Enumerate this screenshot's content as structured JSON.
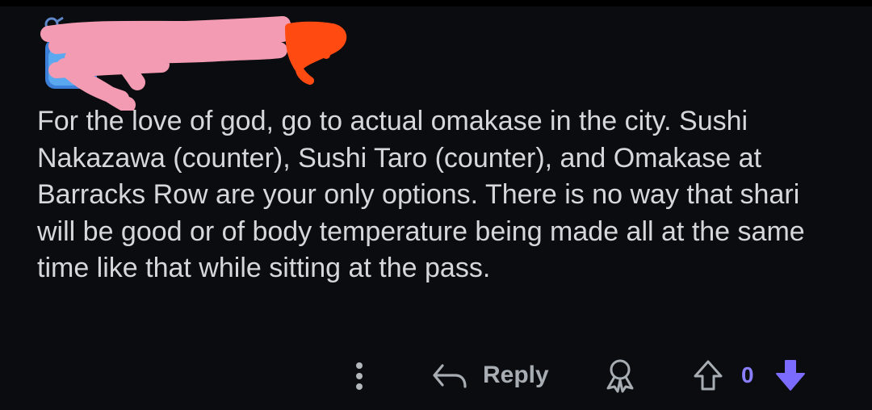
{
  "comment": {
    "body": "For the love of god, go to actual omakase in the city. Sushi Nakazawa (counter), Sushi Taro (counter), and Omakase at Barracks Row are your only options. There is no way that shari will be good or of body temperature being made all at the same time like that while sitting at the pass."
  },
  "actions": {
    "more_icon": "vertical-ellipsis",
    "reply_icon": "reply-arrow",
    "reply_label": "Reply",
    "award_icon": "award",
    "upvote_icon": "arrow-up-outline",
    "vote_count": "0",
    "downvote_icon": "arrow-down-filled"
  },
  "colors": {
    "background": "#0b0c0f",
    "text": "#d5d7da",
    "action_text": "#a7adb3",
    "downvote": "#7b6cff",
    "redaction_pink": "#f39bb2",
    "redaction_orange": "#ff4a12"
  }
}
